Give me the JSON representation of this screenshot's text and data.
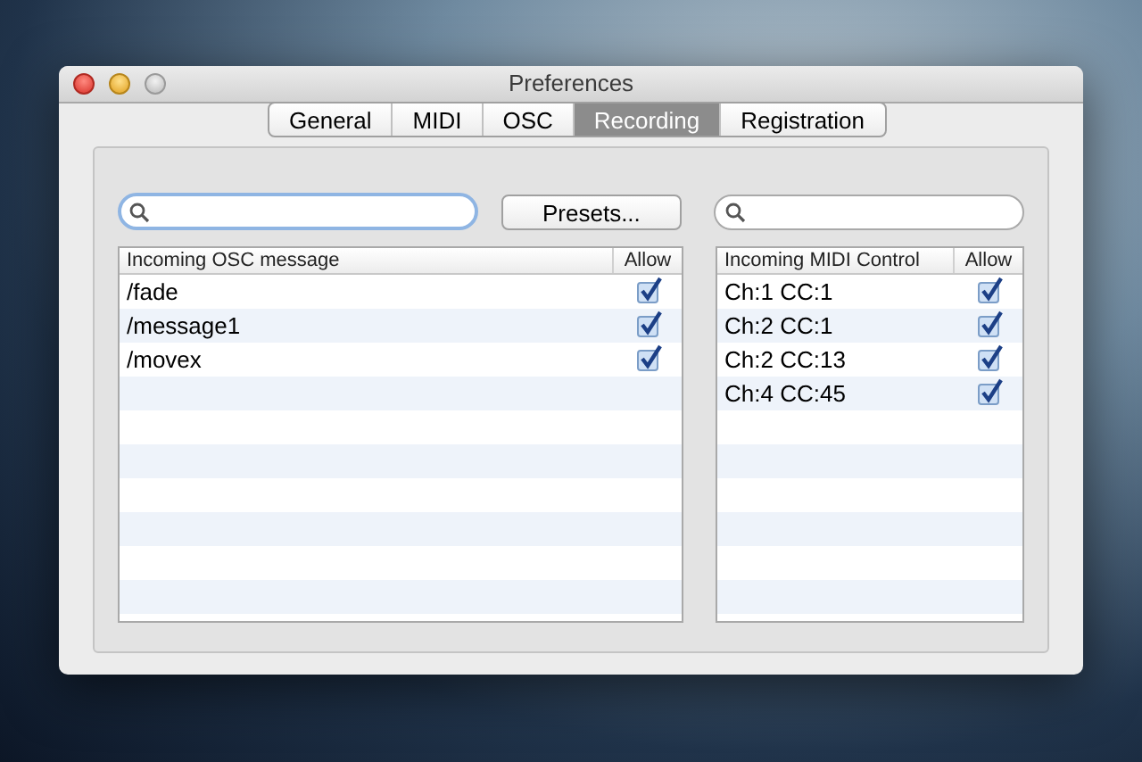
{
  "window": {
    "title": "Preferences"
  },
  "tabs": [
    {
      "label": "General",
      "selected": false
    },
    {
      "label": "MIDI",
      "selected": false
    },
    {
      "label": "OSC",
      "selected": false
    },
    {
      "label": "Recording",
      "selected": true
    },
    {
      "label": "Registration",
      "selected": false
    }
  ],
  "presets_button": "Presets...",
  "osc_table": {
    "columns": [
      "Incoming OSC message",
      "Allow"
    ],
    "rows": [
      {
        "message": "/fade",
        "checked": true
      },
      {
        "message": "/message1",
        "checked": true
      },
      {
        "message": "/movex",
        "checked": true
      }
    ]
  },
  "midi_table": {
    "columns": [
      "Incoming MIDI Control",
      "Allow"
    ],
    "rows": [
      {
        "message": "Ch:1 CC:1",
        "checked": true
      },
      {
        "message": "Ch:2 CC:1",
        "checked": true
      },
      {
        "message": "Ch:2 CC:13",
        "checked": true
      },
      {
        "message": "Ch:4 CC:45",
        "checked": true
      }
    ]
  }
}
